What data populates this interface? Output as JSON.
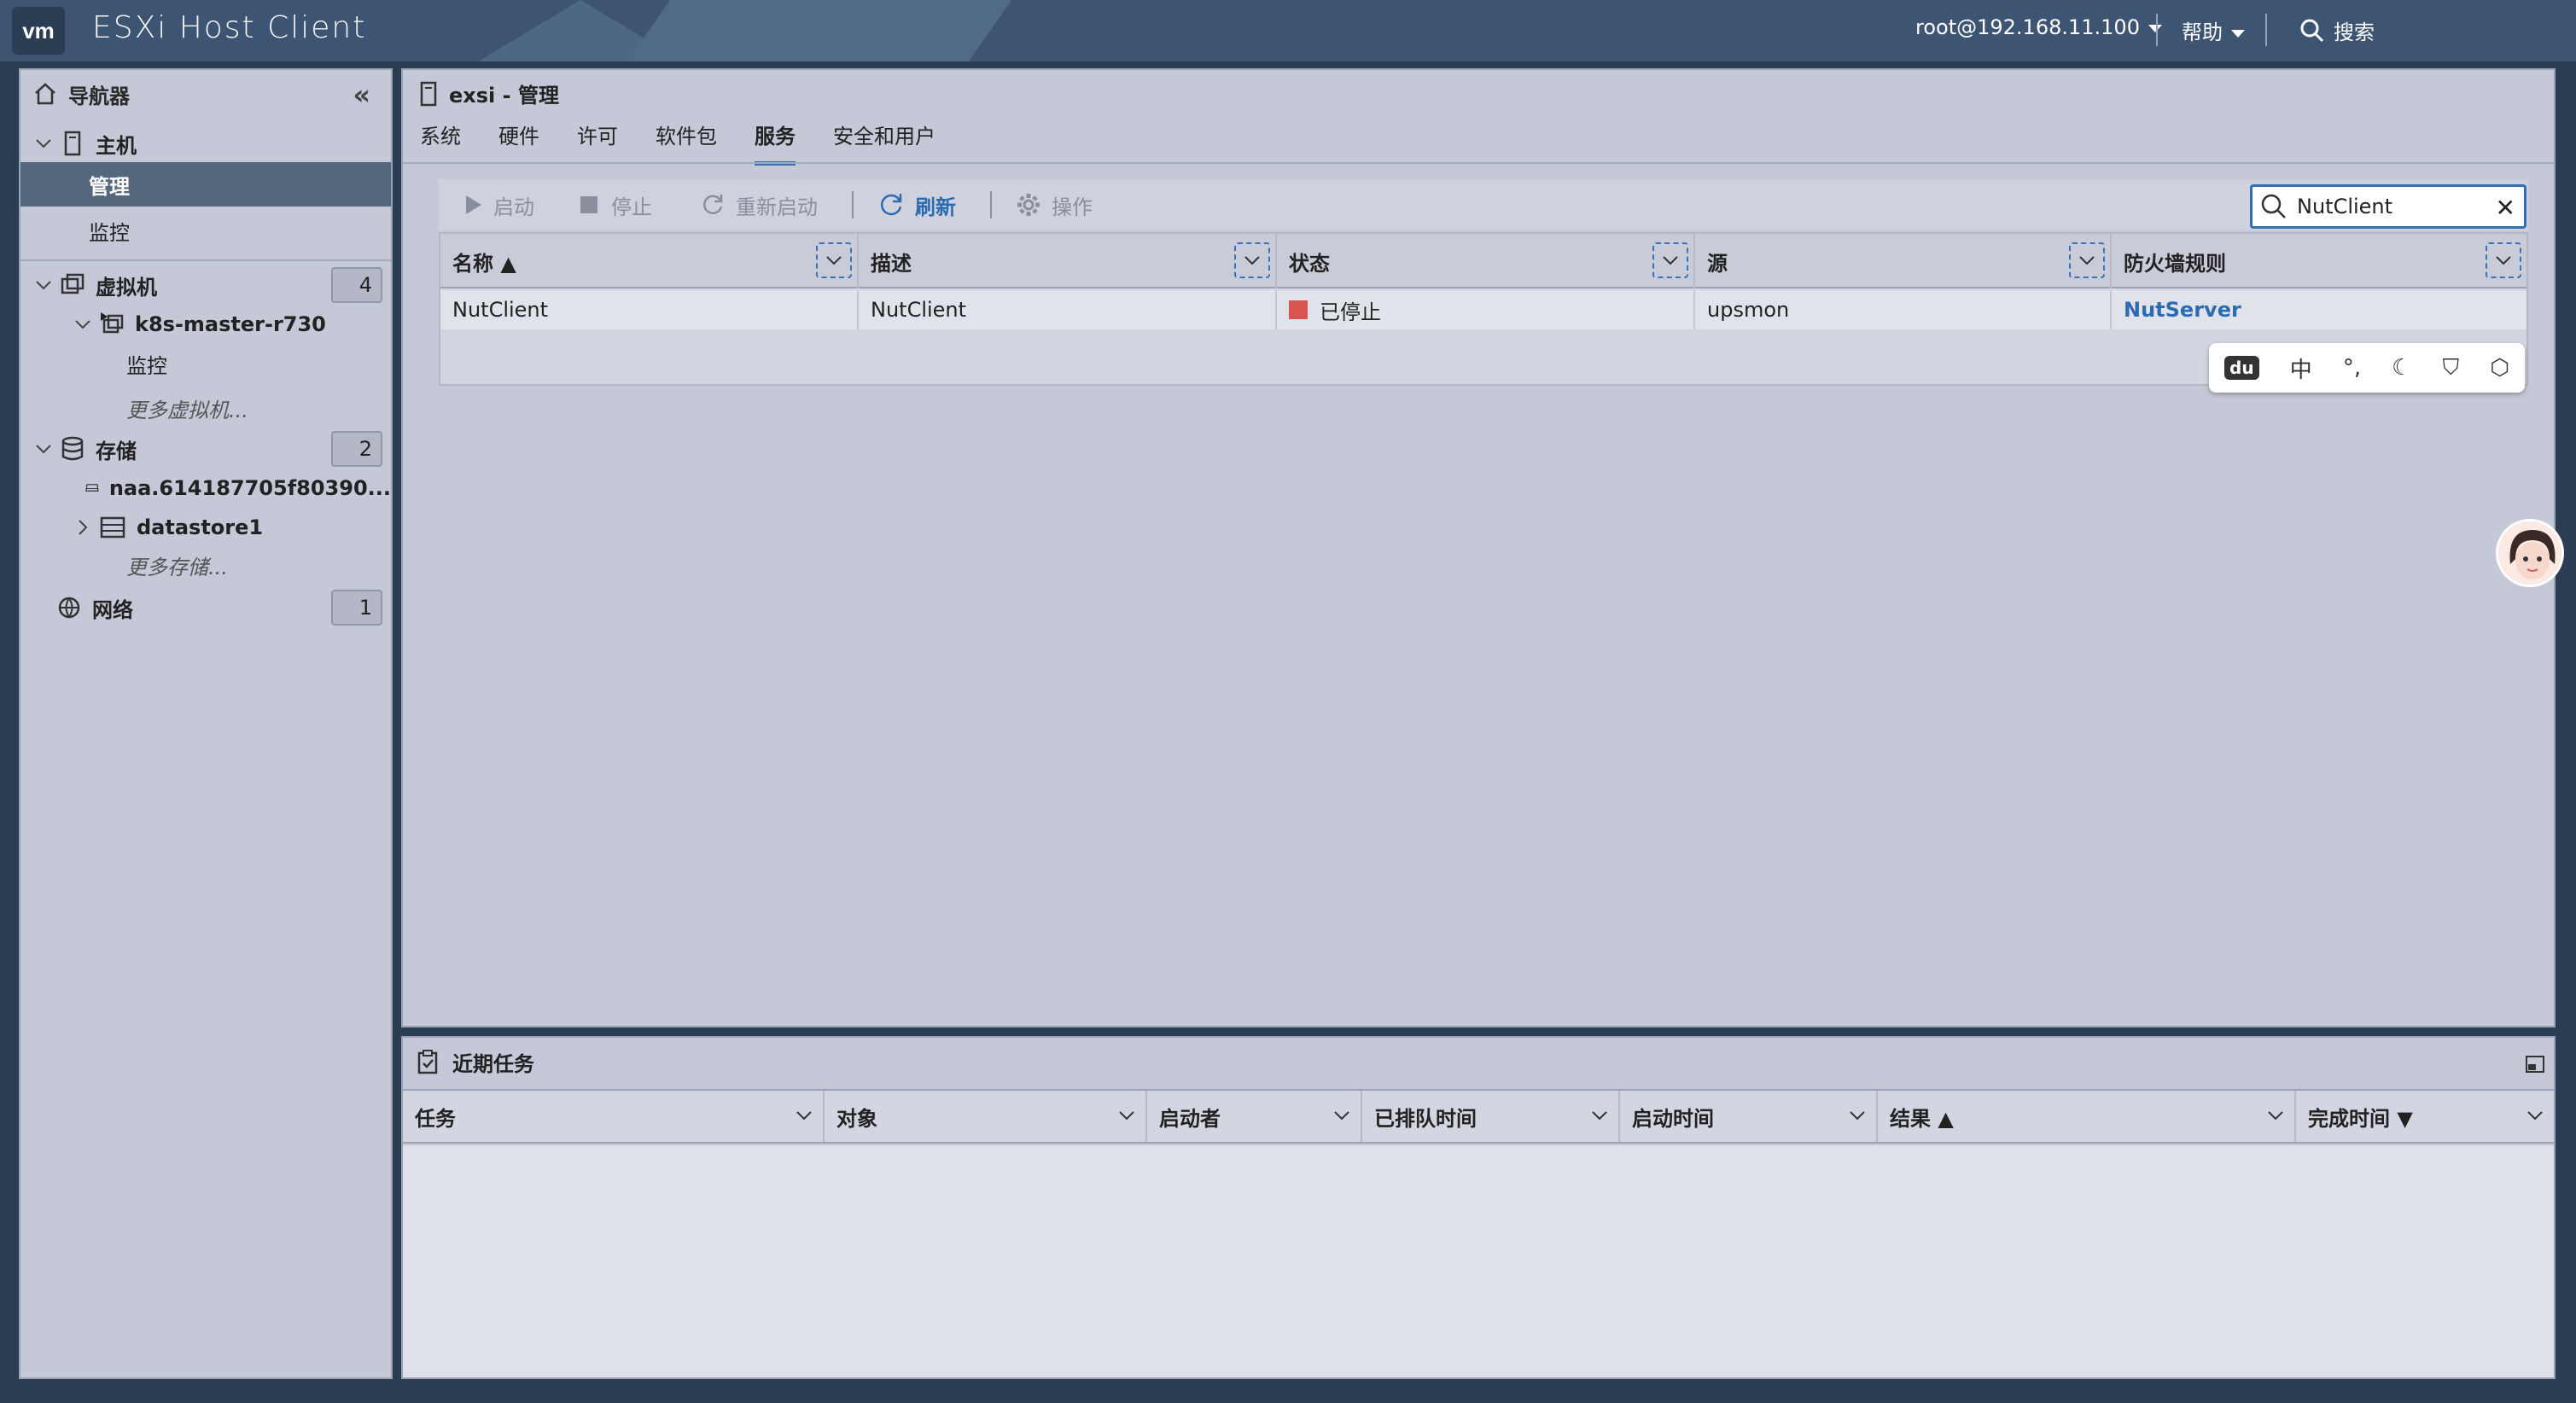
{
  "app": {
    "logo": "vm",
    "title": "ESXi Host Client"
  },
  "header": {
    "user": "root@192.168.11.100",
    "help": "帮助",
    "search": "搜索"
  },
  "navigator": {
    "title": "导航器",
    "host": {
      "label": "主机",
      "items": [
        "管理",
        "监控"
      ]
    },
    "vms": {
      "label": "虚拟机",
      "count": "4",
      "vm_name": "k8s-master-r730",
      "vm_monitor": "监控",
      "more": "更多虚拟机..."
    },
    "storage": {
      "label": "存储",
      "count": "2",
      "items": [
        "naa.614187705f80390...",
        "datastore1"
      ],
      "more": "更多存储..."
    },
    "network": {
      "label": "网络",
      "count": "1"
    }
  },
  "main": {
    "title": "exsi - 管理",
    "tabs": [
      "系统",
      "硬件",
      "许可",
      "软件包",
      "服务",
      "安全和用户"
    ],
    "active_tab": "服务",
    "toolbar": {
      "start": "启动",
      "stop": "停止",
      "restart": "重新启动",
      "refresh": "刷新",
      "actions": "操作"
    },
    "search_value": "NutClient",
    "columns": [
      "名称 ▲",
      "描述",
      "状态",
      "源",
      "防火墙规则"
    ],
    "rows": [
      {
        "name": "NutClient",
        "description": "NutClient",
        "status": "已停止",
        "source": "upsmon",
        "firewall": "NutServer"
      }
    ],
    "ime_bar": {
      "lang": "中",
      "punct": "°,"
    }
  },
  "tasks": {
    "title": "近期任务",
    "columns": [
      "任务",
      "对象",
      "启动者",
      "已排队时间",
      "启动时间",
      "结果 ▲",
      "完成时间 ▼"
    ]
  },
  "colors": {
    "accent": "#3e6fa7",
    "status_stopped": "#d9534f",
    "link": "#2d6bb0"
  }
}
